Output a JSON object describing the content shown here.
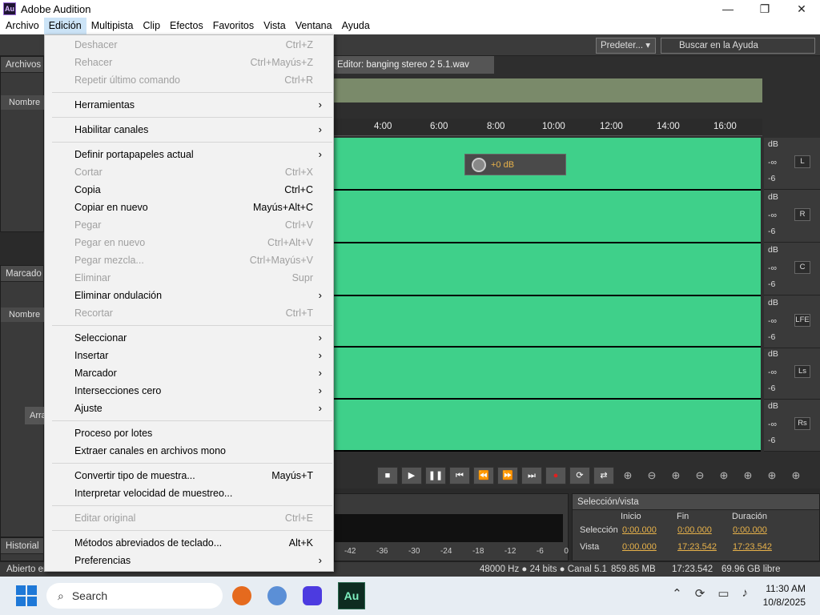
{
  "window": {
    "app_icon": "Au",
    "title": "Adobe Audition",
    "minimize": "—",
    "maximize": "❐",
    "close": "✕"
  },
  "menubar": [
    "Archivo",
    "Edición",
    "Multipista",
    "Clip",
    "Efectos",
    "Favoritos",
    "Vista",
    "Ventana",
    "Ayuda"
  ],
  "toolbar": {
    "workspace": "Predeter...",
    "search_placeholder": "Buscar en la Ayuda"
  },
  "files_panel": {
    "title": "Archivos",
    "col_name": "Nombre"
  },
  "markers_panel": {
    "title": "Marcado",
    "col_name": "Nombre",
    "drag_hint": "Arra"
  },
  "history_panel": {
    "title": "Historial"
  },
  "editor": {
    "tab": "Editor: banging stereo 2 5.1.wav",
    "ruler": [
      "4:00",
      "6:00",
      "8:00",
      "10:00",
      "12:00",
      "14:00",
      "16:00"
    ],
    "volume": "+0 dB",
    "channels": [
      "L",
      "R",
      "C",
      "LFE",
      "Ls",
      "Rs"
    ],
    "db_labels": [
      "dB",
      "-∞",
      "-6"
    ]
  },
  "levels": [
    "-42",
    "-36",
    "-30",
    "-24",
    "-18",
    "-12",
    "-6",
    "0"
  ],
  "selection_panel": {
    "title": "Selección/vista",
    "cols": [
      "Inicio",
      "Fin",
      "Duración"
    ],
    "rows": [
      {
        "label": "Selección",
        "inicio": "0:00.000",
        "fin": "0:00.000",
        "duracion": "0:00.000"
      },
      {
        "label": "Vista",
        "inicio": "0:00.000",
        "fin": "17:23.542",
        "duracion": "17:23.542"
      }
    ]
  },
  "status": {
    "left": "Abierto en",
    "format": "48000 Hz ● 24 bits ● Canal 5.1",
    "size": "859.85 MB",
    "duration": "17:23.542",
    "free": "69.96 GB libre"
  },
  "edit_menu": [
    {
      "label": "Deshacer",
      "shortcut": "Ctrl+Z",
      "disabled": true
    },
    {
      "label": "Rehacer",
      "shortcut": "Ctrl+Mayús+Z",
      "disabled": true
    },
    {
      "label": "Repetir último comando",
      "shortcut": "Ctrl+R",
      "disabled": true
    },
    {
      "sep": true
    },
    {
      "label": "Herramientas",
      "submenu": true
    },
    {
      "sep": true
    },
    {
      "label": "Habilitar canales",
      "submenu": true
    },
    {
      "sep": true
    },
    {
      "label": "Definir portapapeles actual",
      "submenu": true
    },
    {
      "label": "Cortar",
      "shortcut": "Ctrl+X",
      "disabled": true
    },
    {
      "label": "Copia",
      "shortcut": "Ctrl+C"
    },
    {
      "label": "Copiar en nuevo",
      "shortcut": "Mayús+Alt+C"
    },
    {
      "label": "Pegar",
      "shortcut": "Ctrl+V",
      "disabled": true
    },
    {
      "label": "Pegar en nuevo",
      "shortcut": "Ctrl+Alt+V",
      "disabled": true
    },
    {
      "label": "Pegar mezcla...",
      "shortcut": "Ctrl+Mayús+V",
      "disabled": true
    },
    {
      "label": "Eliminar",
      "shortcut": "Supr",
      "disabled": true
    },
    {
      "label": "Eliminar ondulación",
      "submenu": true
    },
    {
      "label": "Recortar",
      "shortcut": "Ctrl+T",
      "disabled": true
    },
    {
      "sep": true
    },
    {
      "label": "Seleccionar",
      "submenu": true
    },
    {
      "label": "Insertar",
      "submenu": true
    },
    {
      "label": "Marcador",
      "submenu": true
    },
    {
      "label": "Intersecciones cero",
      "submenu": true
    },
    {
      "label": "Ajuste",
      "submenu": true
    },
    {
      "sep": true
    },
    {
      "label": "Proceso por lotes"
    },
    {
      "label": "Extraer canales en archivos mono"
    },
    {
      "sep": true
    },
    {
      "label": "Convertir tipo de muestra...",
      "shortcut": "Mayús+T"
    },
    {
      "label": "Interpretar velocidad de muestreo..."
    },
    {
      "sep": true
    },
    {
      "label": "Editar original",
      "shortcut": "Ctrl+E",
      "disabled": true
    },
    {
      "sep": true
    },
    {
      "label": "Métodos abreviados de teclado...",
      "shortcut": "Alt+K"
    },
    {
      "label": "Preferencias",
      "submenu": true
    }
  ],
  "taskbar": {
    "search": "Search",
    "time": "11:30 AM",
    "date": "10/8/2025",
    "app_label": "Au"
  }
}
